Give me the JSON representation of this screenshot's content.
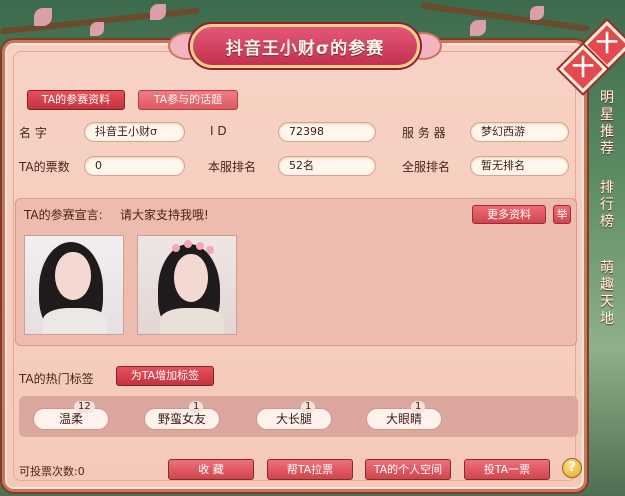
{
  "title": "抖音王小财σ的参赛",
  "tabs": [
    {
      "label": "TA的参赛资料",
      "active": true
    },
    {
      "label": "TA参与的话题",
      "active": false
    }
  ],
  "profile": {
    "name_label": "名    字",
    "name_value": "抖音王小财σ",
    "id_label": "I    D",
    "id_value": "72398",
    "server_label": "服 务 器",
    "server_value": "梦幻西游",
    "votes_label": "TA的票数",
    "votes_value": "0",
    "server_rank_label": "本服排名",
    "server_rank_value": "52名",
    "all_rank_label": "全服排名",
    "all_rank_value": "暂无排名"
  },
  "declaration": {
    "label": "TA的参赛宣言:",
    "text": "请大家支持我哦!",
    "more_label": "更多资料",
    "report_label": "举"
  },
  "tags": {
    "label": "TA的热门标签",
    "add_label": "为TA增加标签",
    "items": [
      {
        "name": "温柔",
        "count": "12"
      },
      {
        "name": "野蛮女友",
        "count": "1"
      },
      {
        "name": "大长腿",
        "count": "1"
      },
      {
        "name": "大眼睛",
        "count": "1"
      }
    ]
  },
  "footer": {
    "vote_count_label": "可投票次数:0",
    "collect_label": "收  藏",
    "canvass_label": "帮TA拉票",
    "space_label": "TA的个人空间",
    "vote_label": "投TA一票",
    "help_label": "?"
  },
  "side_menu": [
    "明星推荐",
    "排行榜",
    "萌趣天地"
  ],
  "colors": {
    "accent": "#d0454f",
    "panel_bg": "#f7d2c4",
    "title_banner": "#c2324f"
  }
}
